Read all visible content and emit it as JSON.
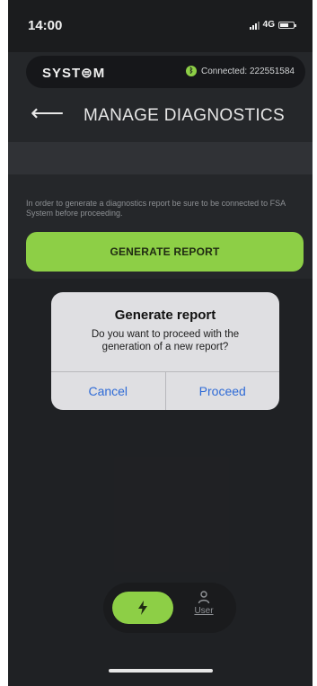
{
  "status_bar": {
    "time": "14:00",
    "network": "4G"
  },
  "brand": {
    "logo": "SYST⊜M",
    "connection_label": "Connected: 222551584",
    "connection_color": "#8dcf46"
  },
  "header": {
    "back_glyph": "⟵",
    "title": "MANAGE DIAGNOSTICS"
  },
  "main": {
    "info_text": "In order to generate a diagnostics report be sure to be connected to FSA System before proceeding.",
    "generate_button": "GENERATE REPORT",
    "accent_color": "#8dcf46"
  },
  "dialog": {
    "title": "Generate report",
    "message": "Do you want to proceed with the generation of a new report?",
    "cancel_label": "Cancel",
    "proceed_label": "Proceed",
    "action_color": "#2f6bd6"
  },
  "bottom_nav": {
    "items": [
      {
        "icon": "lightning-bolt-icon",
        "label": ""
      },
      {
        "icon": "user-icon",
        "label": "User"
      }
    ]
  }
}
